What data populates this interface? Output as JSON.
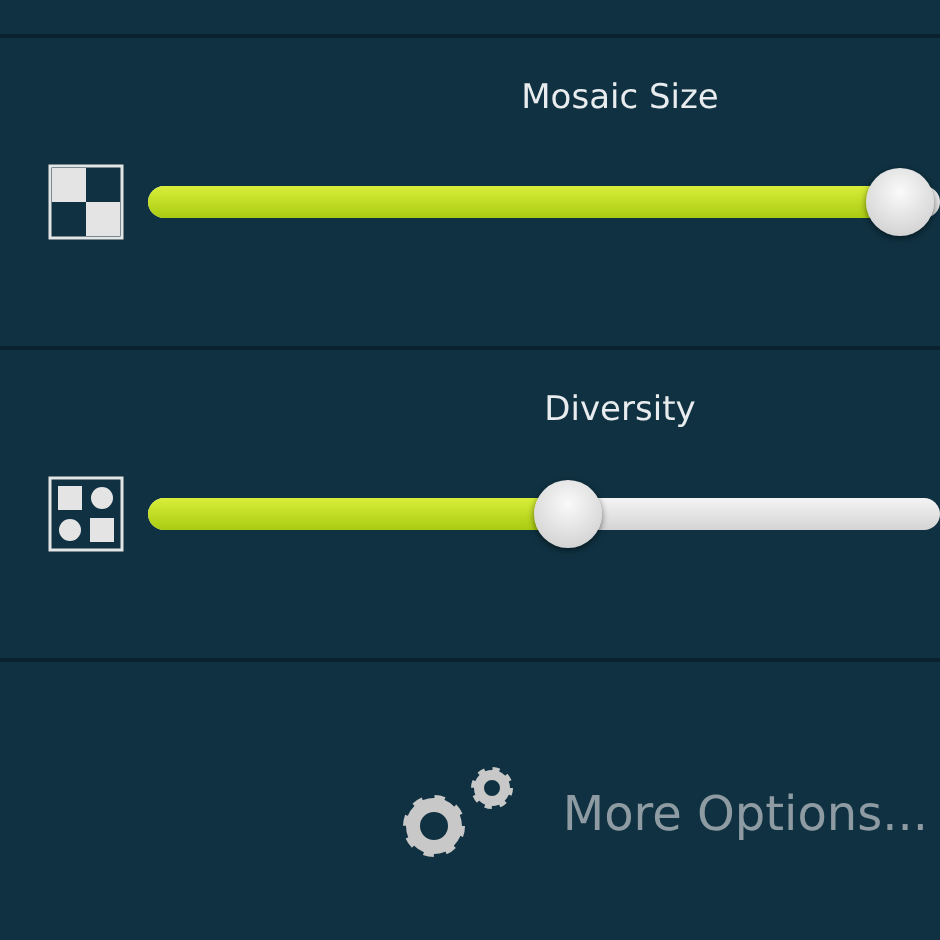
{
  "sliders": [
    {
      "kind": "checker",
      "label": "Mosaic Size",
      "level": 0.95
    },
    {
      "kind": "shapes",
      "label": "Diversity",
      "level": 0.53
    }
  ],
  "more_options": {
    "label": "More Options..."
  }
}
